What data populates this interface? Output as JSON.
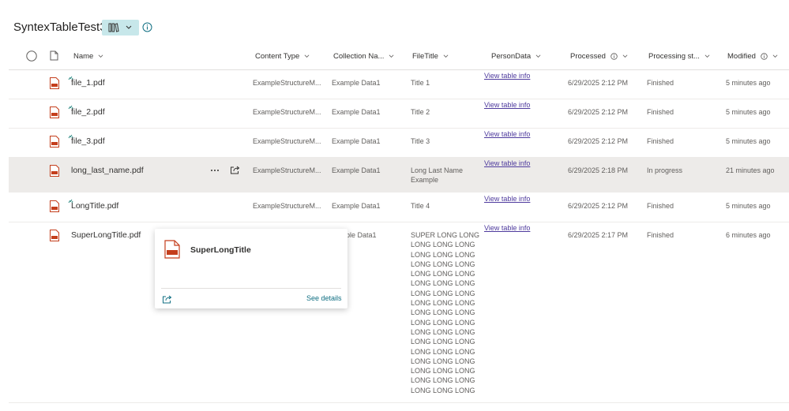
{
  "library": {
    "title": "SyntexTableTest3"
  },
  "columns": [
    "Name",
    "Content Type",
    "Collection Na...",
    "FileTitle",
    "PersonData",
    "Processed",
    "Processing st...",
    "Modified"
  ],
  "rows": [
    {
      "name": "file_1.pdf",
      "content_type": "ExampleStructureM...",
      "collection": "Example Data1",
      "file_title": "Title 1",
      "person_data": "View table info",
      "processed": "6/29/2025 2:12 PM",
      "status": "Finished",
      "modified": "5 minutes ago"
    },
    {
      "name": "file_2.pdf",
      "content_type": "ExampleStructureM...",
      "collection": "Example Data1",
      "file_title": "Title 2",
      "person_data": "View table info",
      "processed": "6/29/2025 2:12 PM",
      "status": "Finished",
      "modified": "5 minutes ago"
    },
    {
      "name": "file_3.pdf",
      "content_type": "ExampleStructureM...",
      "collection": "Example Data1",
      "file_title": "Title 3",
      "person_data": "View table info",
      "processed": "6/29/2025 2:12 PM",
      "status": "Finished",
      "modified": "5 minutes ago"
    },
    {
      "name": "long_last_name.pdf",
      "content_type": "ExampleStructureM...",
      "collection": "Example Data1",
      "file_title_line1": "Long Last Name",
      "file_title_line2": "Example",
      "person_data": "View table info",
      "processed": "6/29/2025 2:18 PM",
      "status": "In progress",
      "modified": "21 minutes ago"
    },
    {
      "name": "LongTitle.pdf",
      "content_type": "ExampleStructureM...",
      "collection": "Example Data1",
      "file_title": "Title 4",
      "person_data": "View table info",
      "processed": "6/29/2025 2:12 PM",
      "status": "Finished",
      "modified": "5 minutes ago"
    },
    {
      "name": "SuperLongTitle.pdf",
      "collection_partial": "ple Data1",
      "person_data": "View table info",
      "processed": "6/29/2025 2:17 PM",
      "status": "Finished",
      "modified": "6 minutes ago",
      "file_title_lines": [
        "SUPER LONG LONG",
        "LONG LONG LONG",
        "LONG LONG LONG",
        "LONG LONG LONG",
        "LONG LONG LONG",
        "LONG LONG LONG",
        "LONG LONG LONG",
        "LONG LONG LONG",
        "LONG LONG LONG",
        "LONG LONG LONG",
        "LONG LONG LONG",
        "LONG LONG LONG",
        "LONG LONG LONG",
        "LONG LONG LONG",
        "LONG LONG LONG",
        "LONG LONG LONG",
        "LONG LONG LONG"
      ]
    }
  ],
  "hover_card": {
    "title": "SuperLongTitle",
    "see_details": "See details"
  },
  "colors": {
    "accent": "#0f6e82",
    "link": "#4e3a9d",
    "pdf_red": "#c43e1c",
    "selected_row": "#edebe9",
    "view_button": "#c7e7ea"
  },
  "icons": [
    "library-view-icon",
    "chevron-down-icon",
    "info-icon",
    "select-all-circle-icon",
    "file-type-icon",
    "pdf-icon",
    "new-item-sparkle-icon",
    "more-actions-icon",
    "share-icon"
  ]
}
